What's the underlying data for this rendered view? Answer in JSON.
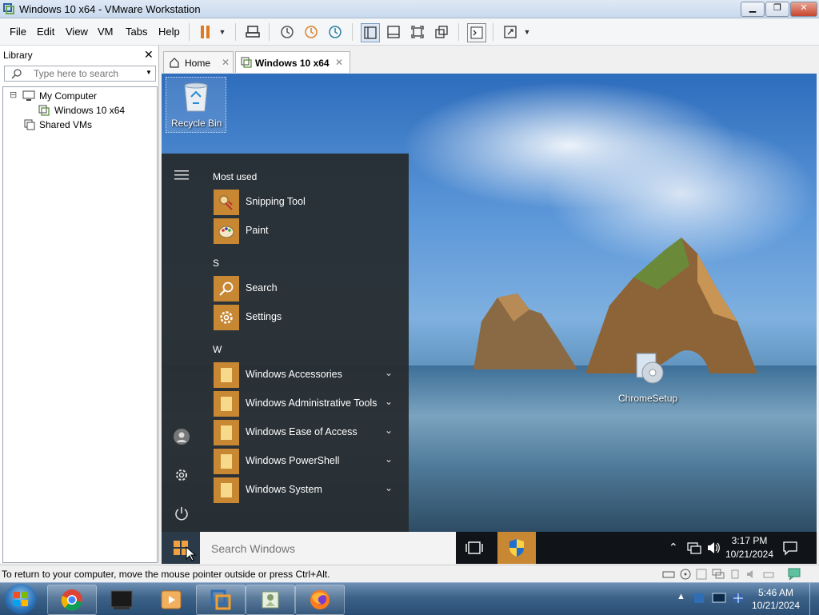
{
  "window": {
    "title": "Windows 10 x64 - VMware Workstation",
    "minimize": "▁",
    "restore": "❐",
    "close": "✕"
  },
  "menubar": {
    "items": [
      "File",
      "Edit",
      "View",
      "VM",
      "Tabs",
      "Help"
    ]
  },
  "library": {
    "title": "Library",
    "close": "✕",
    "search_placeholder": "Type here to search",
    "tree": [
      {
        "label": "My Computer",
        "expander": "⊟"
      },
      {
        "label": "Windows 10 x64"
      },
      {
        "label": "Shared VMs"
      }
    ]
  },
  "tabs": [
    {
      "label": "Home",
      "close": "✕"
    },
    {
      "label": "Windows 10 x64",
      "close": "✕"
    }
  ],
  "desktop": {
    "icons": [
      {
        "label": "Recycle Bin"
      },
      {
        "label": "ChromeSetup"
      }
    ]
  },
  "start_menu": {
    "header_most_used": "Most used",
    "most_used": [
      "Snipping Tool",
      "Paint"
    ],
    "group_s": "S",
    "s_items": [
      "Search",
      "Settings"
    ],
    "group_w": "W",
    "w_items": [
      "Windows Accessories",
      "Windows Administrative Tools",
      "Windows Ease of Access",
      "Windows PowerShell",
      "Windows System"
    ],
    "chevron": "⌄"
  },
  "vm_taskbar": {
    "search_placeholder": "Search Windows",
    "time": "3:17 PM",
    "date": "10/21/2024"
  },
  "statusbar": {
    "text": "To return to your computer, move the mouse pointer outside or press Ctrl+Alt."
  },
  "host_taskbar": {
    "time": "5:46 AM",
    "date": "10/21/2024"
  },
  "colors": {
    "tile": "#c88733",
    "start_bg": "#282e32",
    "title_close": "#c7452e"
  }
}
